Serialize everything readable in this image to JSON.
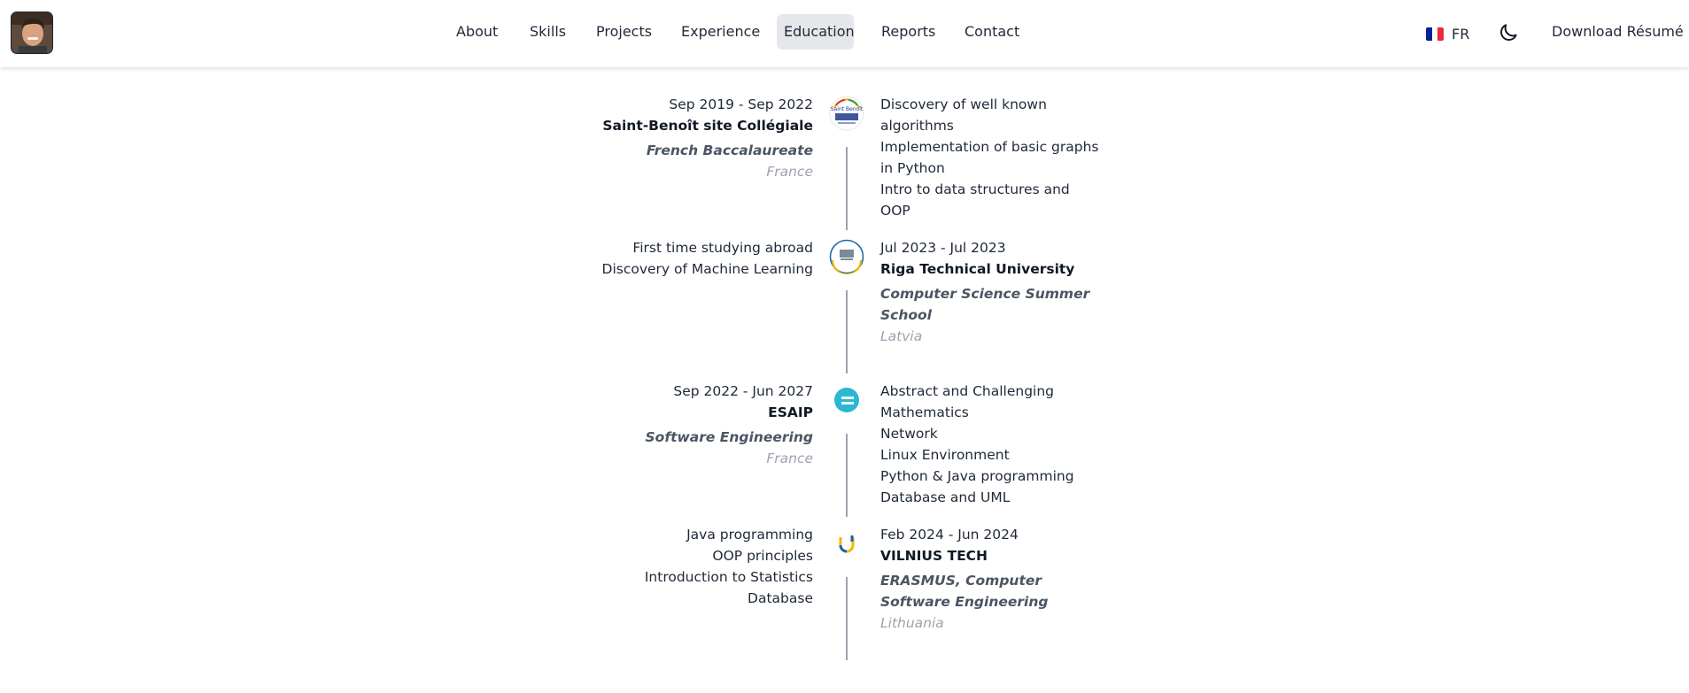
{
  "header": {
    "nav": [
      {
        "label": "About"
      },
      {
        "label": "Skills"
      },
      {
        "label": "Projects"
      },
      {
        "label": "Experience"
      },
      {
        "label": "Education",
        "active": true
      },
      {
        "label": "Reports"
      },
      {
        "label": "Contact"
      }
    ],
    "language": {
      "label": "FR",
      "flag_colors": [
        "#002395",
        "#ffffff",
        "#ed2939"
      ]
    },
    "theme_icon": "moon-icon",
    "download_label": "Download Résumé"
  },
  "education": [
    {
      "dates": "Sep 2019 - Sep 2022",
      "institution": "Saint-Benoît site Collégiale",
      "degree": "French Baccalaureate",
      "country": "France",
      "items": [
        "Discovery of well known algorithms",
        "Implementation of basic graphs in Python",
        "Intro to data structures and OOP"
      ],
      "logo": "saint-benoit-logo",
      "logo_text": "Saint Benoît"
    },
    {
      "dates": "Jul 2023 - Jul 2023",
      "institution": "Riga Technical University",
      "degree": "Computer Science Summer School",
      "country": "Latvia",
      "items": [
        "First time studying abroad",
        "Discovery of Machine Learning"
      ],
      "logo": "rtu-logo"
    },
    {
      "dates": "Sep 2022 - Jun 2027",
      "institution": "ESAIP",
      "degree": "Software Engineering",
      "country": "France",
      "items": [
        "Abstract and Challenging Mathematics",
        "Network",
        "Linux Environment",
        "Python & Java programming",
        "Database and UML"
      ],
      "logo": "esaip-logo"
    },
    {
      "dates": "Feb 2024 - Jun 2024",
      "institution": "VILNIUS TECH",
      "degree": "ERASMUS, Computer Software Engineering",
      "country": "Lithuania",
      "items": [
        "Java programming",
        "OOP principles",
        "Introduction to Statistics",
        "Database"
      ],
      "logo": "vilnius-tech-logo"
    }
  ]
}
